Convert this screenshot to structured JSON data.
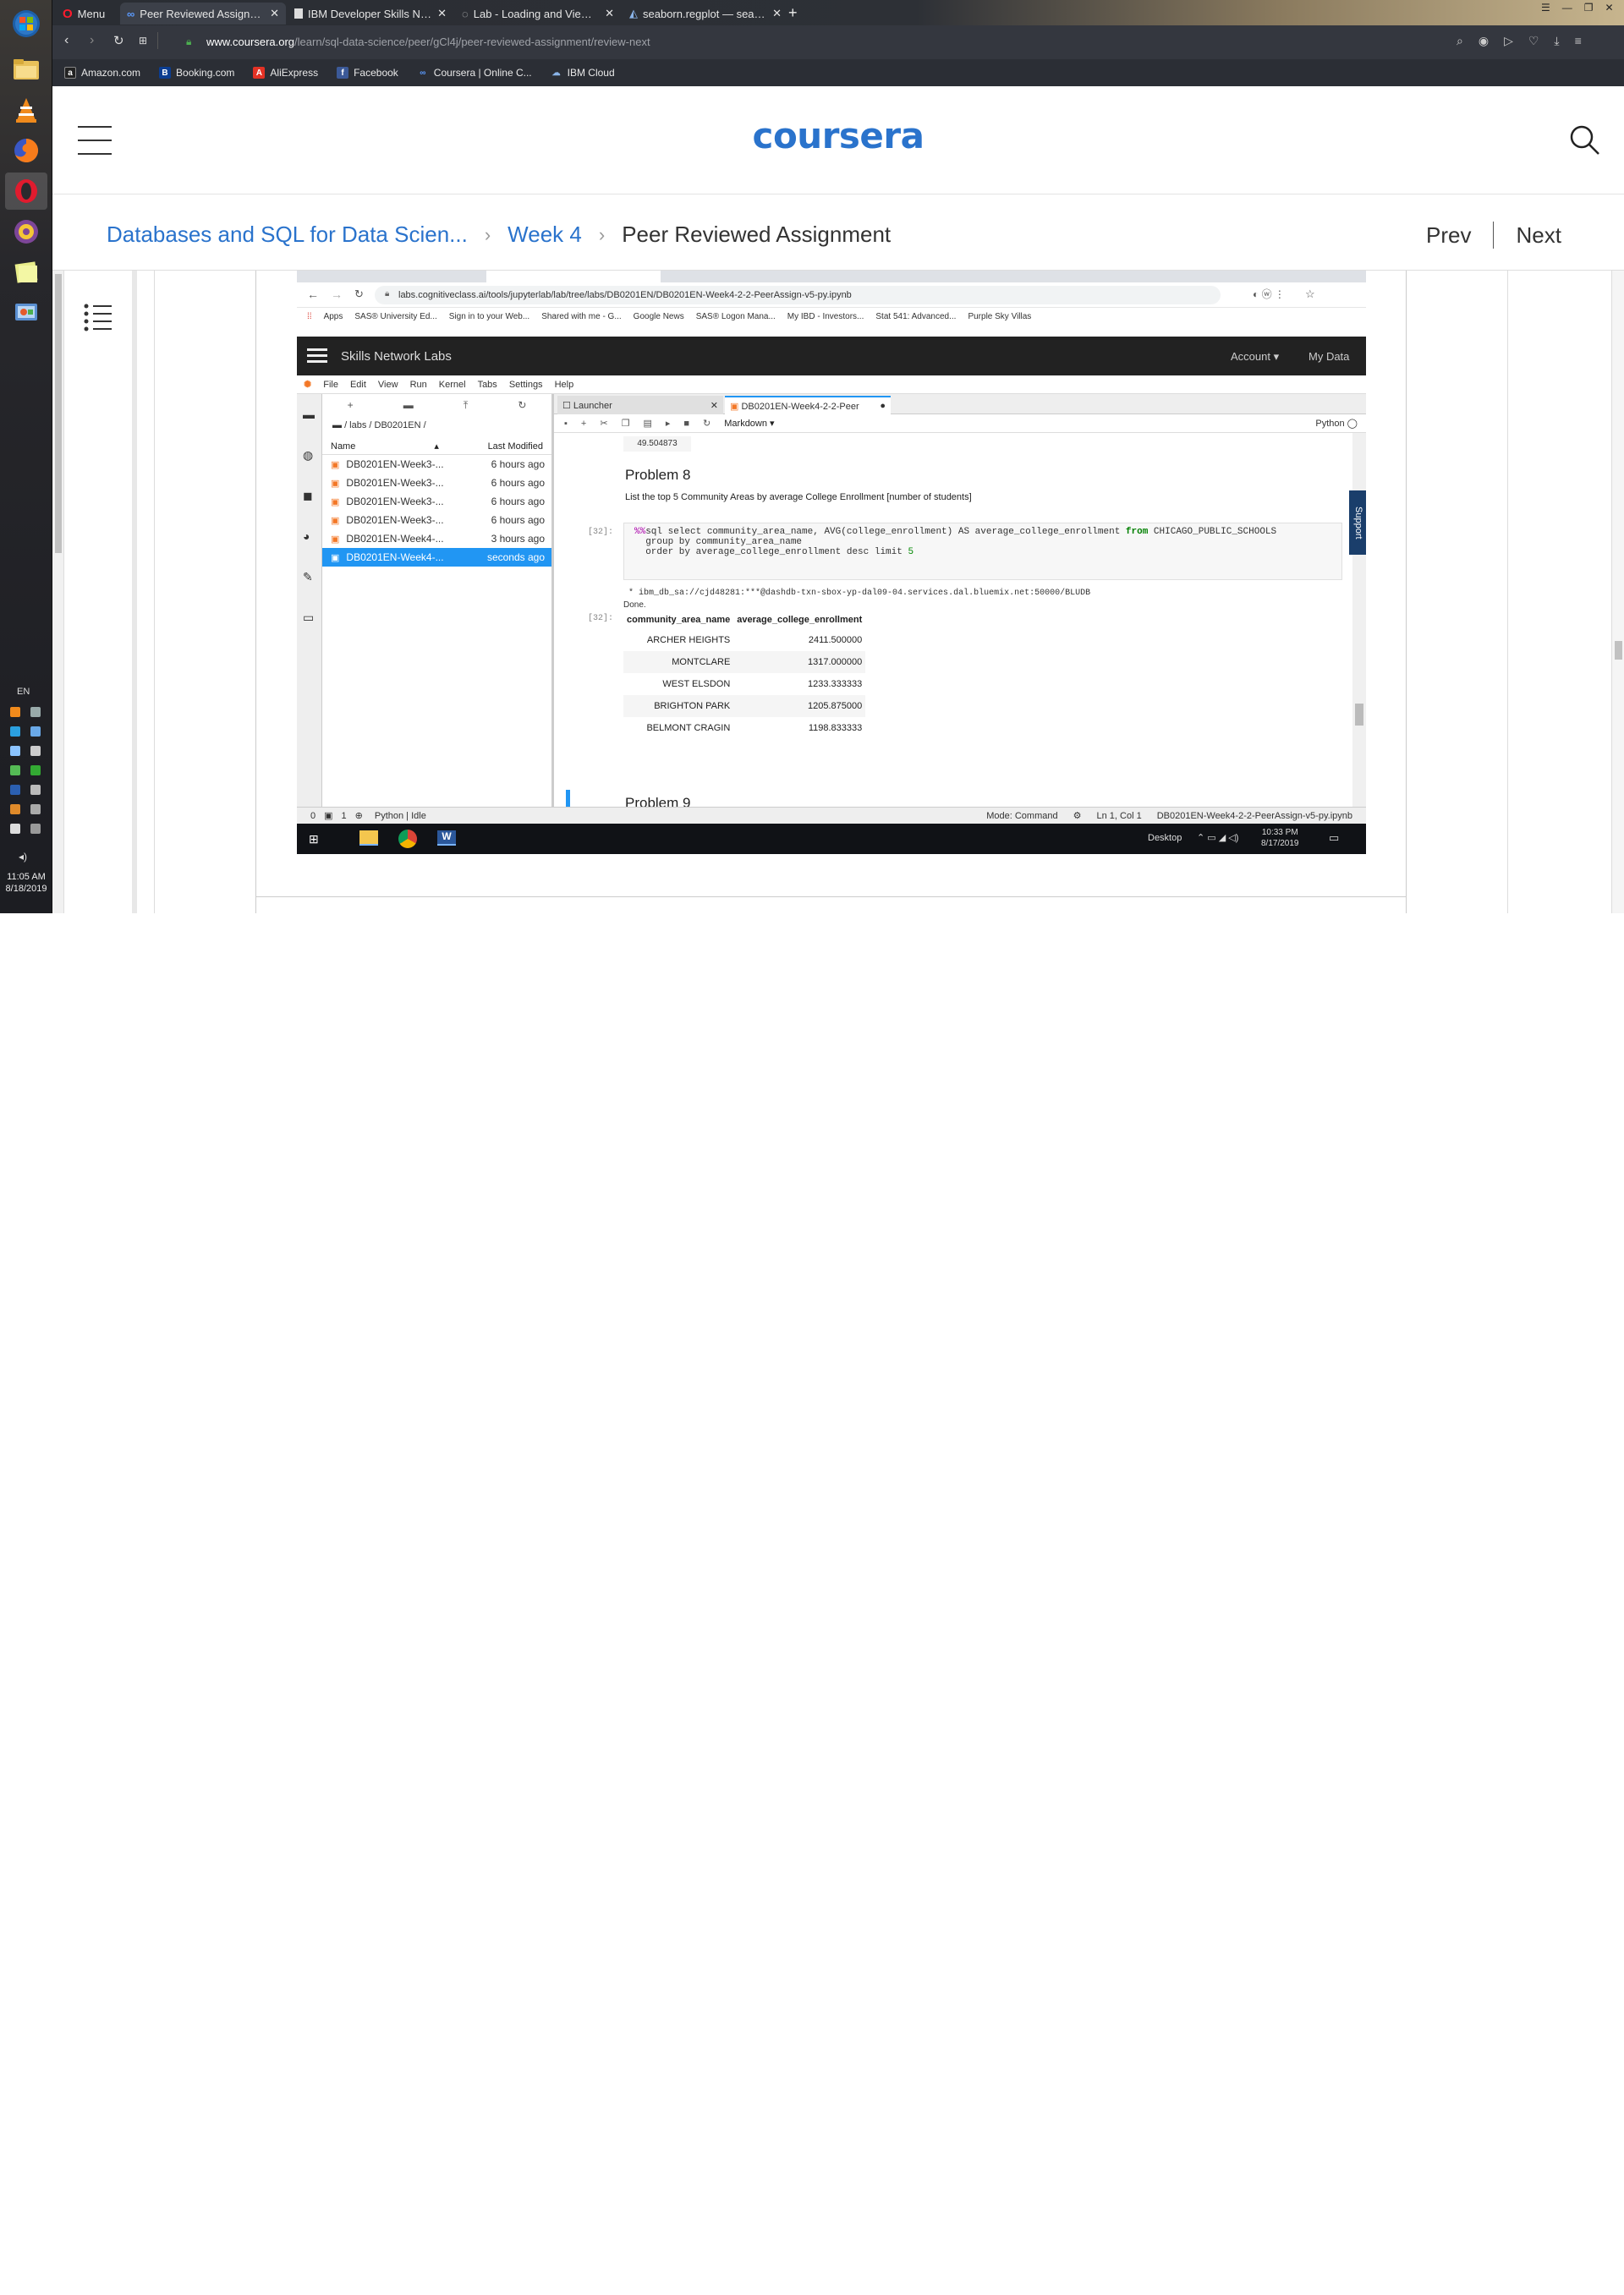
{
  "os": {
    "clock_time": "11:05 AM",
    "clock_date": "8/18/2019",
    "language": "EN"
  },
  "browser": {
    "tabs": [
      {
        "label": "Menu"
      },
      {
        "label": "Peer Reviewed Assignment"
      },
      {
        "label": "IBM Developer Skills Netw"
      },
      {
        "label": "Lab - Loading and Viewing"
      },
      {
        "label": "seaborn.regplot — seaborn"
      }
    ],
    "url_host": "www.coursera.org",
    "url_path": "/learn/sql-data-science/peer/gCl4j/peer-reviewed-assignment/review-next",
    "bookmarks": [
      {
        "label": "Amazon.com",
        "icon": "amazon-icon",
        "color": "#222222"
      },
      {
        "label": "Booking.com",
        "icon": "booking-icon",
        "color": "#0b3d91"
      },
      {
        "label": "AliExpress",
        "icon": "aliexpress-icon",
        "color": "#e43225"
      },
      {
        "label": "Facebook",
        "icon": "facebook-icon",
        "color": "#3b5998"
      },
      {
        "label": "Coursera | Online C...",
        "icon": "coursera-icon",
        "color": "#2a73cc"
      },
      {
        "label": "IBM Cloud",
        "icon": "ibm-cloud-icon",
        "color": "#4178be"
      }
    ]
  },
  "coursera": {
    "logo": "coursera",
    "brand_color": "#2a73cc",
    "breadcrumb": {
      "course": "Databases and SQL for Data Scien...",
      "week": "Week 4",
      "current": "Peer Reviewed Assignment"
    },
    "prev_label": "Prev",
    "next_label": "Next"
  },
  "embedded": {
    "inner_url": "labs.cognitiveclass.ai/tools/jupyterlab/lab/tree/labs/DB0201EN/DB0201EN-Week4-2-2-PeerAssign-v5-py.ipynb",
    "inner_bookmarks": [
      "Apps",
      "SAS® University Ed...",
      "Sign in to your Web...",
      "Shared with me - G...",
      "Google News",
      "SAS® Logon Mana...",
      "My IBD - Investors...",
      "Stat 541: Advanced...",
      "Purple Sky Villas"
    ],
    "skills_title": "Skills Network Labs",
    "account_label": "Account",
    "my_data_label": "My Data",
    "menu": [
      "File",
      "Edit",
      "View",
      "Run",
      "Kernel",
      "Tabs",
      "Settings",
      "Help"
    ],
    "breadcrumb_path": "/ labs / DB0201EN /",
    "files_header_name": "Name",
    "files_header_modified": "Last Modified",
    "files": [
      {
        "name": "DB0201EN-Week3-...",
        "modified": "6 hours ago"
      },
      {
        "name": "DB0201EN-Week3-...",
        "modified": "6 hours ago"
      },
      {
        "name": "DB0201EN-Week3-...",
        "modified": "6 hours ago"
      },
      {
        "name": "DB0201EN-Week3-...",
        "modified": "6 hours ago"
      },
      {
        "name": "DB0201EN-Week4-...",
        "modified": "3 hours ago"
      },
      {
        "name": "DB0201EN-Week4-...",
        "modified": "seconds ago",
        "selected": true
      }
    ],
    "tab_launcher": "Launcher",
    "tab_notebook": "DB0201EN-Week4-2-2-Peer",
    "cell_type": "Markdown",
    "kernel_name": "Python",
    "prev_output": "49.504873",
    "problem8_title": "Problem 8",
    "problem8_text": "List the top 5 Community Areas by average College Enrollment [number of students]",
    "prompt_in": "[32]:",
    "code_magic": "%%",
    "code_line1": "sql select community_area_name, AVG(college_enrollment) AS average_college_enrollment ",
    "code_kw_from": "from",
    "code_table": " CHICAGO_PUBLIC_SCHOOLS",
    "code_line2": "  group by community_area_name",
    "code_line3": "  order by average_college_enrollment desc limit ",
    "code_limit": "5",
    "conn_string": " * ibm_db_sa://cjd48281:***@dashdb-txn-sbox-yp-dal09-04.services.dal.bluemix.net:50000/BLUDB",
    "done_text": "Done.",
    "prompt_out": "[32]:",
    "result_headers": [
      "community_area_name",
      "average_college_enrollment"
    ],
    "results": [
      [
        "ARCHER HEIGHTS",
        "2411.500000"
      ],
      [
        "MONTCLARE",
        "1317.000000"
      ],
      [
        "WEST ELSDON",
        "1233.333333"
      ],
      [
        "BRIGHTON PARK",
        "1205.875000"
      ],
      [
        "BELMONT CRAGIN",
        "1198.833333"
      ]
    ],
    "problem9_title": "Problem 9",
    "support_label": "Support",
    "status_left_0": "0",
    "status_left_1": "1",
    "status_kernel": "Python | Idle",
    "status_mode": "Mode: Command",
    "status_pos": "Ln 1, Col 1",
    "status_file": "DB0201EN-Week4-2-2-PeerAssign-v5-py.ipynb",
    "win_desktop": "Desktop",
    "win_time": "10:33 PM",
    "win_date": "8/17/2019"
  }
}
